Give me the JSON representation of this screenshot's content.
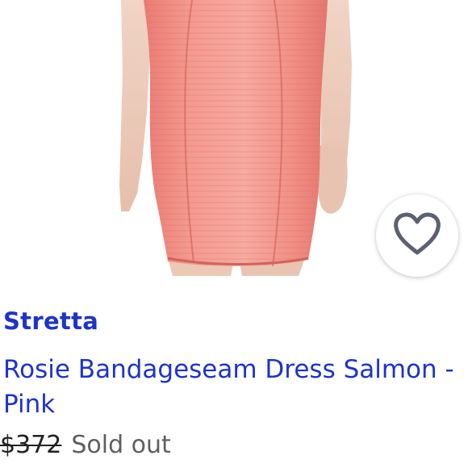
{
  "listing": {
    "brand": "Stretta",
    "title_line1": "Rosie Bandageseam Dress Salmon -",
    "title_line2": "Pink",
    "original_price": "$372",
    "status": "Sold out"
  },
  "icons": {
    "like": "heart-outline-icon"
  },
  "colors": {
    "brand_blue": "#1e34c8",
    "dress_salmon": "#f08a80",
    "heart_gray": "#5d6072"
  }
}
